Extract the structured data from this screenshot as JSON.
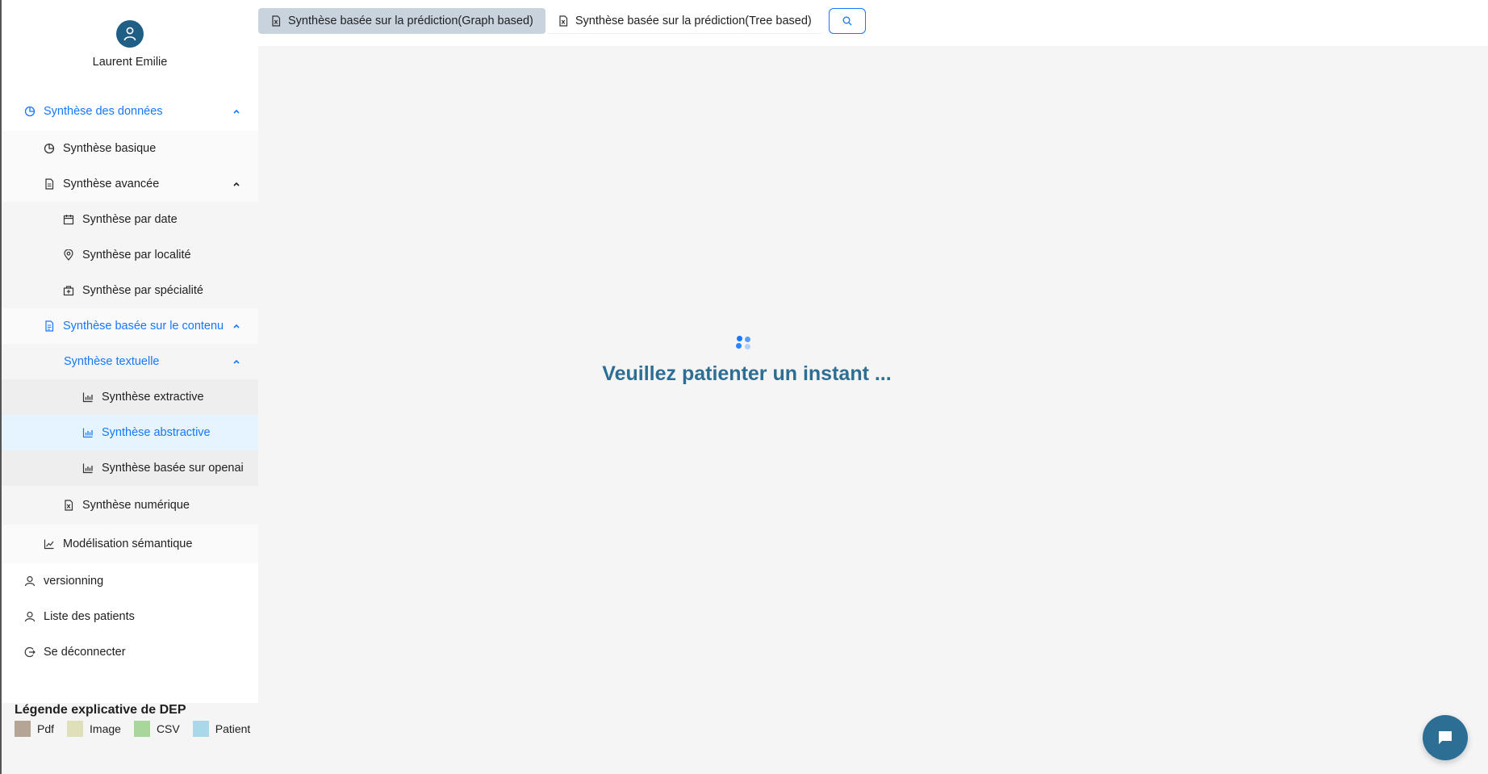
{
  "profile": {
    "name": "Laurent Emilie",
    "avatar_icon": "user-icon"
  },
  "menu": {
    "synthese_donnees": "Synthèse des données",
    "synthese_basique": "Synthèse basique",
    "synthese_avancee": "Synthèse avancée",
    "synthese_date": "Synthèse par date",
    "synthese_localite": "Synthèse par localité",
    "synthese_specialite": "Synthèse par spécialité",
    "synthese_contenu": "Synthèse basée sur le contenu",
    "synthese_textuelle": "Synthèse textuelle",
    "synthese_extractive": "Synthèse extractive",
    "synthese_abstractive": "Synthèse abstractive",
    "synthese_openai": "Synthèse basée sur openai",
    "synthese_numerique": "Synthèse numérique",
    "modelisation": "Modélisation sémantique",
    "versionning": "versionning",
    "liste_patients": "Liste des patients",
    "deconnecter": "Se déconnecter"
  },
  "legend": {
    "title": "Légende explicative de DEP",
    "items": [
      {
        "label": "Pdf",
        "color": "#b5a597"
      },
      {
        "label": "Image",
        "color": "#dfdfb9"
      },
      {
        "label": "CSV",
        "color": "#a8d69b"
      },
      {
        "label": "Patient",
        "color": "#a9d8e9"
      }
    ]
  },
  "tabs": {
    "graph": "Synthèse basée sur la prédiction(Graph based)",
    "tree": "Synthèse basée sur la prédiction(Tree based)",
    "search_icon": "search-icon"
  },
  "main": {
    "loading_text": "Veuillez patienter un instant ..."
  },
  "colors": {
    "accent": "#1677ff",
    "brand": "#2d6e94"
  }
}
